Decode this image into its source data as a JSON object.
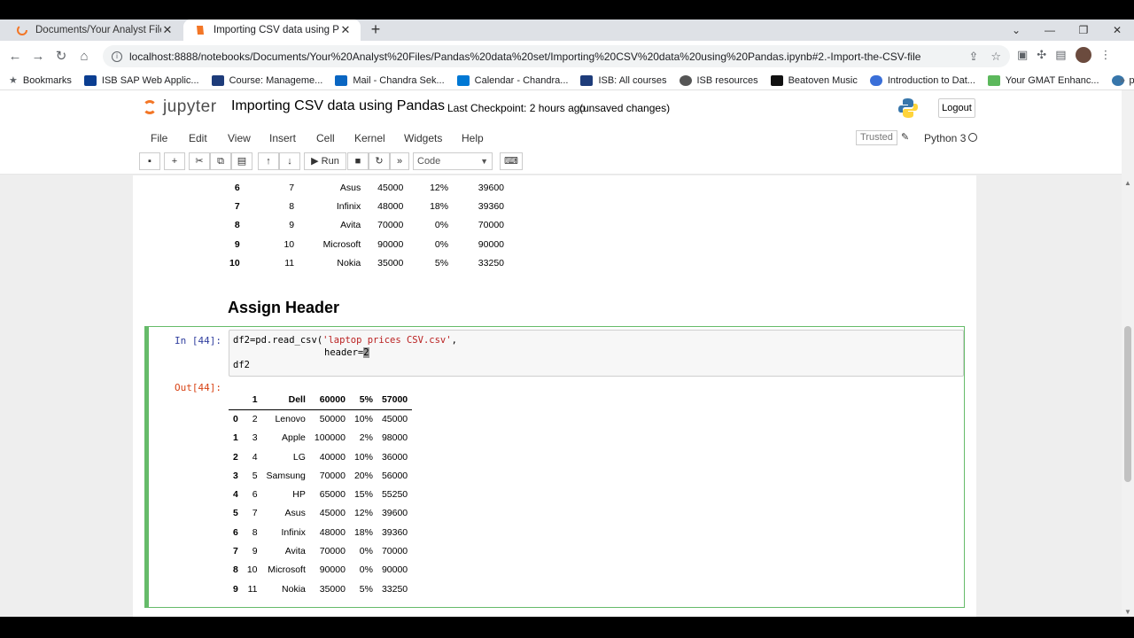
{
  "browser": {
    "tabs": [
      {
        "title": "Documents/Your Analyst Files/Pa",
        "active": false
      },
      {
        "title": "Importing CSV data using Panda",
        "active": true
      }
    ],
    "url": "localhost:8888/notebooks/Documents/Your%20Analyst%20Files/Pandas%20data%20set/Importing%20CSV%20data%20using%20Pandas.ipynb#2.-Import-the-CSV-file",
    "bookmarks": [
      "Bookmarks",
      "ISB SAP Web Applic...",
      "Course: Manageme...",
      "Mail - Chandra Sek...",
      "Calendar - Chandra...",
      "ISB: All courses",
      "ISB resources",
      "Beatoven Music",
      "Introduction to Dat...",
      "Your GMAT Enhanc...",
      "python"
    ]
  },
  "jupyter": {
    "logo_text": "jupyter",
    "notebook_title": "Importing CSV data using Pandas",
    "checkpoint": "Last Checkpoint: 2 hours ago",
    "unsaved": "(unsaved changes)",
    "logout": "Logout",
    "menu": [
      "File",
      "Edit",
      "View",
      "Insert",
      "Cell",
      "Kernel",
      "Widgets",
      "Help"
    ],
    "trusted": "Trusted",
    "kernel": "Python 3",
    "run_label": "Run",
    "cell_type": "Code"
  },
  "top_table": {
    "rows": [
      [
        "6",
        "7",
        "Asus",
        "45000",
        "12%",
        "39600"
      ],
      [
        "7",
        "8",
        "Infinix",
        "48000",
        "18%",
        "39360"
      ],
      [
        "8",
        "9",
        "Avita",
        "70000",
        "0%",
        "70000"
      ],
      [
        "9",
        "10",
        "Microsoft",
        "90000",
        "0%",
        "90000"
      ],
      [
        "10",
        "11",
        "Nokia",
        "35000",
        "5%",
        "33250"
      ]
    ]
  },
  "heading": "Assign Header",
  "cell": {
    "in_prompt": "In [44]:",
    "out_prompt": "Out[44]:",
    "code_line1_a": "df2=pd.read_csv(",
    "code_line1_str": "'laptop prices CSV.csv'",
    "code_line1_b": ",",
    "code_line2": "header=",
    "code_line2_cursor": "2",
    "code_line3": "df2"
  },
  "output_table": {
    "columns": [
      "",
      "1",
      "Dell",
      "60000",
      "5%",
      "57000"
    ],
    "rows": [
      [
        "0",
        "2",
        "Lenovo",
        "50000",
        "10%",
        "45000"
      ],
      [
        "1",
        "3",
        "Apple",
        "100000",
        "2%",
        "98000"
      ],
      [
        "2",
        "4",
        "LG",
        "40000",
        "10%",
        "36000"
      ],
      [
        "3",
        "5",
        "Samsung",
        "70000",
        "20%",
        "56000"
      ],
      [
        "4",
        "6",
        "HP",
        "65000",
        "15%",
        "55250"
      ],
      [
        "5",
        "7",
        "Asus",
        "45000",
        "12%",
        "39600"
      ],
      [
        "6",
        "8",
        "Infinix",
        "48000",
        "18%",
        "39360"
      ],
      [
        "7",
        "9",
        "Avita",
        "70000",
        "0%",
        "70000"
      ],
      [
        "8",
        "10",
        "Microsoft",
        "90000",
        "0%",
        "90000"
      ],
      [
        "9",
        "11",
        "Nokia",
        "35000",
        "5%",
        "33250"
      ]
    ]
  }
}
